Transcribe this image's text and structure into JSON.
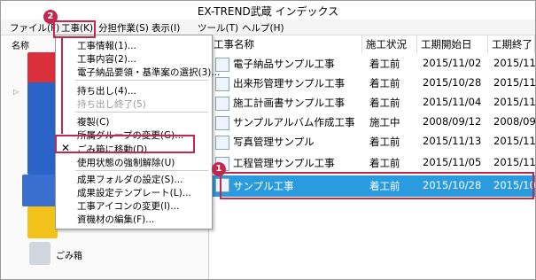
{
  "window": {
    "title": "EX-TREND武蔵 インデックス"
  },
  "menubar": [
    {
      "label": "ファイル(F)"
    },
    {
      "label": "工事(K)"
    },
    {
      "label": "分担作業(S)"
    },
    {
      "label": "表示(I)"
    },
    {
      "label": "ツール(T)"
    },
    {
      "label": "ヘルプ(H)"
    }
  ],
  "left_panel": {
    "header": "名称",
    "trash_label": "ごみ箱"
  },
  "dropdown": {
    "items": [
      {
        "label": "工事情報(1)..."
      },
      {
        "label": "工事内容(2)..."
      },
      {
        "label": "電子納品要領・基準案の選択(3)..."
      },
      {
        "label": "持ち出し(4)..."
      },
      {
        "label": "持ち出し終了(5)"
      },
      {
        "label": "複製(C)"
      },
      {
        "label": "所属グループの変更(G)..."
      },
      {
        "label": "ごみ箱に移動(D)"
      },
      {
        "label": "使用状態の強制解除(U)"
      },
      {
        "label": "成果フォルダの設定(S)..."
      },
      {
        "label": "成果設定テンプレート(L)..."
      },
      {
        "label": "工事アイコンの変更(I)..."
      },
      {
        "label": "資機材の編集(F)..."
      }
    ]
  },
  "list": {
    "columns": [
      "工事名称",
      "施工状況",
      "工期開始日",
      "工期終了"
    ],
    "rows": [
      [
        "電子納品サンプル工事",
        "着工前",
        "2015/11/02",
        "2015/11"
      ],
      [
        "出来形管理サンプル工事",
        "着工前",
        "2015/10/28",
        "2015/11"
      ],
      [
        "施工計画書サンプル工事",
        "着工前",
        "2015/11/04",
        "2015/11"
      ],
      [
        "サンプルアルバム作成工事",
        "施工中",
        "2008/09/12",
        "2008/09"
      ],
      [
        "写真管理サンプル",
        "着工前",
        "2015/11/13",
        "2015/11"
      ],
      [
        "工程管理サンプル工事",
        "着工前",
        "2015/11/05",
        "2015/11"
      ],
      [
        "サンプル工事",
        "着工前",
        "2015/10/28",
        "2015/10"
      ]
    ]
  },
  "badges": {
    "one": "1",
    "two": "2"
  },
  "colors": {
    "selection": "#2b9be0",
    "highlight": "#c0294d"
  }
}
